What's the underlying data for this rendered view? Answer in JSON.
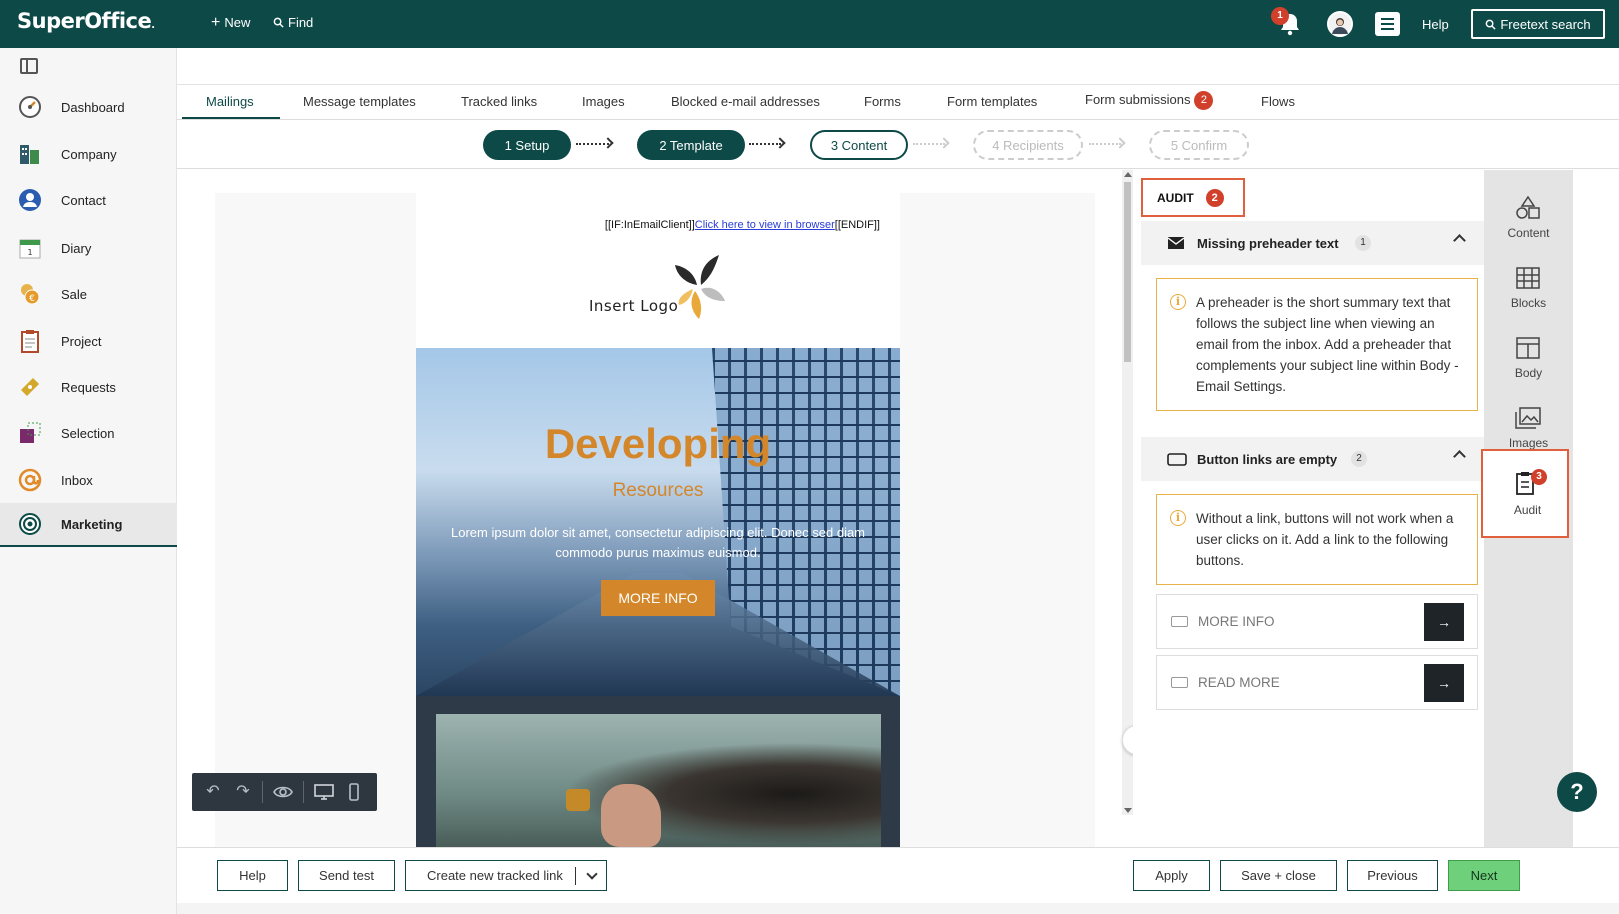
{
  "app": {
    "logo": "SuperOffice",
    "new_label": "New",
    "find_label": "Find",
    "notifications_count": "1",
    "help_label": "Help",
    "freetext_label": "Freetext search"
  },
  "sidebar": {
    "items": [
      {
        "label": "Dashboard",
        "icon": "dashboard-icon"
      },
      {
        "label": "Company",
        "icon": "company-icon"
      },
      {
        "label": "Contact",
        "icon": "contact-icon"
      },
      {
        "label": "Diary",
        "icon": "diary-icon"
      },
      {
        "label": "Sale",
        "icon": "sale-icon"
      },
      {
        "label": "Project",
        "icon": "project-icon"
      },
      {
        "label": "Requests",
        "icon": "requests-icon"
      },
      {
        "label": "Selection",
        "icon": "selection-icon"
      },
      {
        "label": "Inbox",
        "icon": "inbox-icon"
      },
      {
        "label": "Marketing",
        "icon": "marketing-icon"
      }
    ],
    "active": "Marketing"
  },
  "tabs": {
    "items": [
      "Mailings",
      "Message templates",
      "Tracked links",
      "Images",
      "Blocked e-mail addresses",
      "Forms",
      "Form templates",
      "Form submissions",
      "Flows"
    ],
    "active": "Mailings",
    "form_submissions_badge": "2"
  },
  "steps": [
    "1 Setup",
    "2 Template",
    "3 Content",
    "4 Recipients",
    "5 Confirm"
  ],
  "email": {
    "conditional_prefix": "[[IF:InEmailClient]]",
    "view_link": "Click here to view in browser",
    "conditional_suffix": "[[ENDIF]]",
    "logo_text": "Insert Logo",
    "hero_title": "Developing",
    "hero_subtitle": "Resources",
    "hero_body": "Lorem ipsum dolor sit amet, consectetur adipiscing elit. Donec sed diam commodo purus maximus euismod.",
    "hero_cta": "MORE INFO"
  },
  "audit": {
    "title": "AUDIT",
    "count": "2",
    "sections": [
      {
        "title": "Missing preheader text",
        "count": "1",
        "message": "A preheader is the short summary text that follows the subject line when viewing an email from the inbox. Add a preheader that complements your subject line within Body - Email Settings."
      },
      {
        "title": "Button links are empty",
        "count": "2",
        "message": "Without a link, buttons will not work when a user clicks on it. Add a link to the following buttons.",
        "buttons": [
          "MORE INFO",
          "READ MORE"
        ]
      }
    ]
  },
  "rail": {
    "items": [
      "Content",
      "Blocks",
      "Body",
      "Images",
      "Audit"
    ],
    "audit_badge": "3"
  },
  "bottom": {
    "help": "Help",
    "send_test": "Send test",
    "create_link": "Create new tracked link",
    "apply": "Apply",
    "save_close": "Save + close",
    "previous": "Previous",
    "next": "Next"
  },
  "colors": {
    "brand": "#0d4a47",
    "badge": "#d0402b",
    "accent_orange": "#d4862a",
    "highlight_border": "#e0603e",
    "next_green": "#6fd07c"
  }
}
